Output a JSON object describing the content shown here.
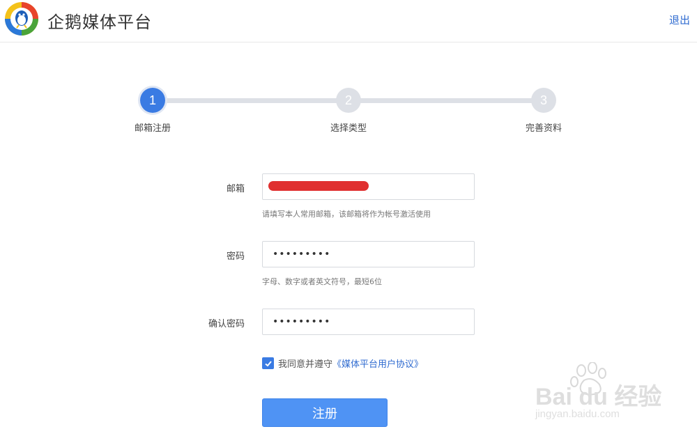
{
  "header": {
    "brand": "企鹅媒体平台",
    "logout": "退出"
  },
  "steps": [
    {
      "number": "1",
      "label": "邮箱注册",
      "active": true
    },
    {
      "number": "2",
      "label": "选择类型",
      "active": false
    },
    {
      "number": "3",
      "label": "完善资料",
      "active": false
    }
  ],
  "form": {
    "email": {
      "label": "邮箱",
      "value": "",
      "hint": "请填写本人常用邮箱，该邮箱将作为帐号激活使用"
    },
    "password": {
      "label": "密码",
      "value": "•••••••••",
      "hint": "字母、数字或者英文符号，最短6位"
    },
    "confirm": {
      "label": "确认密码",
      "value": "•••••••••"
    },
    "agree": {
      "text": "我同意并遵守",
      "link": "《媒体平台用户协议》",
      "checked": true
    },
    "submit": "注册"
  },
  "watermark": {
    "brand": "Bai du 经验",
    "url": "jingyan.baidu.com"
  },
  "colors": {
    "accent": "#3a7be3",
    "link": "#2f6bd0",
    "redaction": "#e03030"
  }
}
